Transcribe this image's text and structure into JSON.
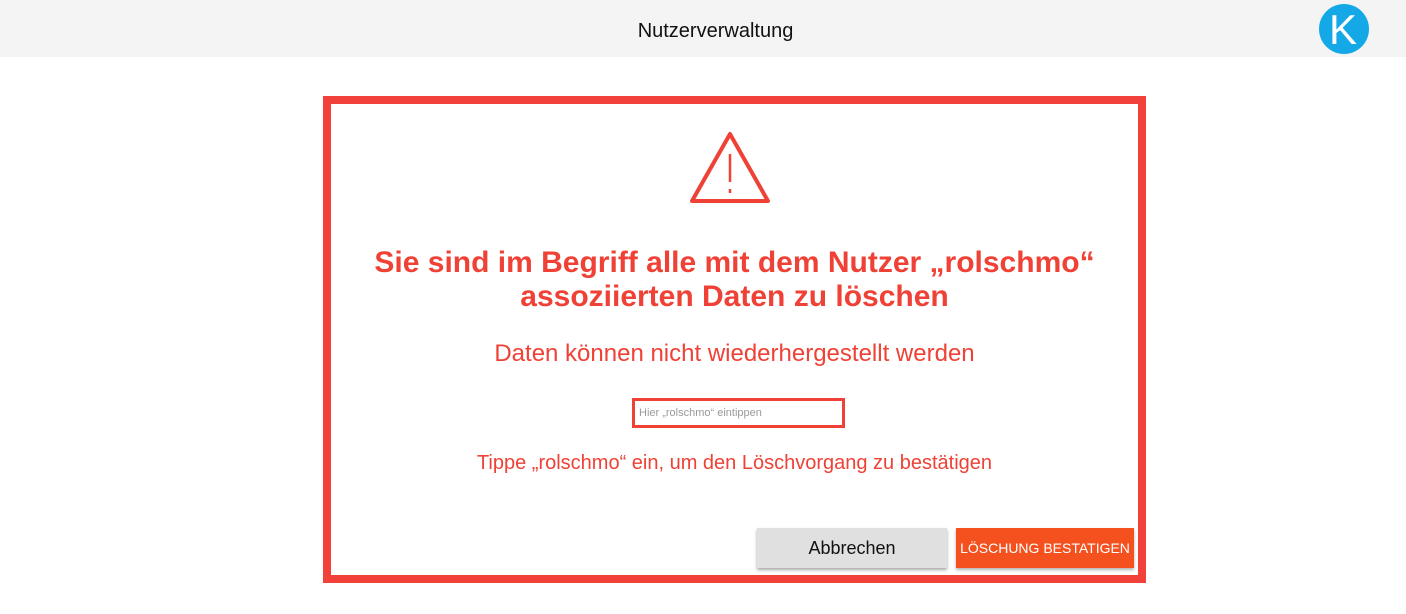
{
  "header": {
    "title": "Nutzerverwaltung",
    "logo_letter": "K",
    "logo_color": "#15a8e6"
  },
  "dialog": {
    "icon": "warning-triangle-icon",
    "accent_color": "#ef4135",
    "headline_line1": "Sie sind im Begriff alle mit dem Nutzer „rolschmo“",
    "headline_line2": "assoziierten Daten zu löschen",
    "subline": "Daten können nicht wiederhergestellt werden",
    "input_placeholder": "Hier „rolschmo“ eintippen",
    "input_value": "",
    "hint": "Tippe „rolschmo“ ein, um den Löschvorgang zu bestätigen",
    "cancel_label": "Abbrechen",
    "confirm_label": "LÖSCHUNG BESTATIGEN",
    "confirm_color": "#f5511f"
  }
}
